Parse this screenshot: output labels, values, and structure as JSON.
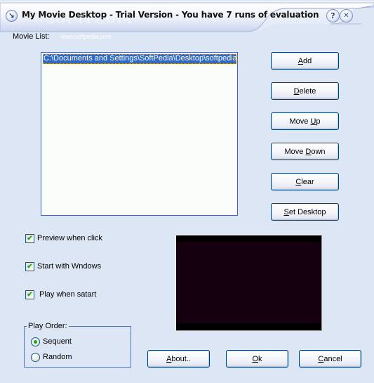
{
  "window": {
    "title": "My Movie Desktop - Trial Version - You have 7 runs of evaluation",
    "help_glyph": "?",
    "close_glyph": "✕",
    "app_icon_glyph": "↘",
    "watermark": "SOFTPEDIA",
    "watermark_url": "www.softpedia.com"
  },
  "movie_list": {
    "label": "Movie List:",
    "items": [
      {
        "path": "C:\\Documents and Settings\\SoftPedia\\Desktop\\softpedia",
        "selected": true
      }
    ]
  },
  "buttons": {
    "add": {
      "pre": "",
      "key": "A",
      "post": "dd"
    },
    "delete": {
      "pre": "",
      "key": "D",
      "post": "elete"
    },
    "move_up": {
      "pre": "Move ",
      "key": "U",
      "post": "p"
    },
    "move_down": {
      "pre": "Move ",
      "key": "D",
      "post": "own"
    },
    "clear": {
      "pre": "",
      "key": "C",
      "post": "lear"
    },
    "set_desktop": {
      "pre": "",
      "key": "S",
      "post": "et Desktop"
    },
    "about": {
      "pre": "",
      "key": "A",
      "post": "bout.."
    },
    "ok": {
      "pre": "",
      "key": "O",
      "post": "k"
    },
    "cancel": {
      "pre": "",
      "key": "C",
      "post": "ancel"
    }
  },
  "options": {
    "preview_when_click": {
      "label": "Preview when click",
      "checked": true,
      "glyph": "✔"
    },
    "start_with_windows": {
      "label": "Start with Wndows",
      "checked": true,
      "glyph": "✔"
    },
    "play_when_start": {
      "label": "Play when satart",
      "checked": true,
      "glyph": "✔"
    }
  },
  "play_order": {
    "label": "Play Order:",
    "options": [
      {
        "label": "Sequent",
        "selected": true
      },
      {
        "label": "Random",
        "selected": false
      }
    ]
  },
  "colors": {
    "background": "#dde6f4",
    "selection": "#316ac5",
    "check": "#21a121",
    "preview_bg": "#14000f"
  }
}
